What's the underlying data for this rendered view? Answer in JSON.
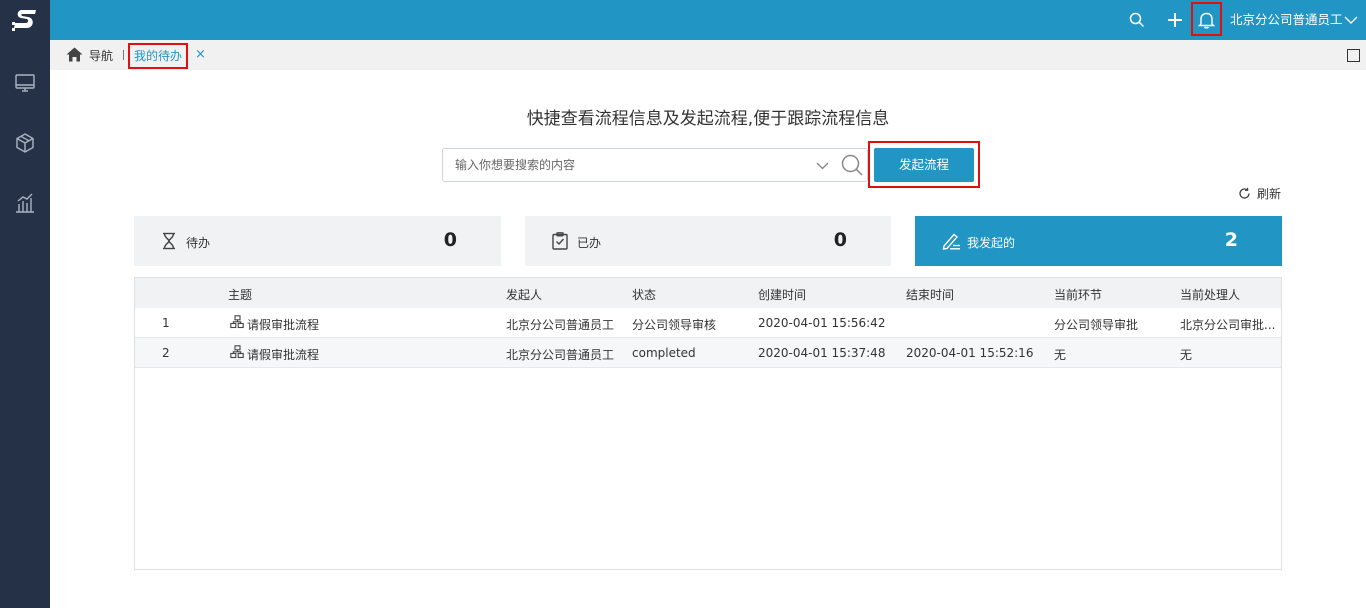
{
  "header": {
    "user_name": "北京分公司普通员工"
  },
  "icons": {
    "logo": "s-logo-icon",
    "sidebar": [
      "monitor-icon",
      "cube-icon",
      "bar-chart-icon"
    ],
    "header": [
      "search-icon",
      "plus-icon",
      "bell-icon",
      "chevron-down-icon"
    ]
  },
  "tabs": {
    "nav_label": "导航",
    "active_label": "我的待办",
    "close_glyph": "×"
  },
  "main": {
    "headline": "快捷查看流程信息及发起流程,便于跟踪流程信息",
    "search_placeholder": "输入你想要搜索的内容",
    "start_button": "发起流程",
    "refresh_label": "刷新"
  },
  "cards": [
    {
      "label": "待办",
      "count": "0",
      "icon": "hourglass-icon"
    },
    {
      "label": "已办",
      "count": "0",
      "icon": "clipboard-check-icon"
    },
    {
      "label": "我发起的",
      "count": "2",
      "icon": "edit-icon"
    }
  ],
  "table": {
    "columns": [
      "主题",
      "发起人",
      "状态",
      "创建时间",
      "结束时间",
      "当前环节",
      "当前处理人"
    ],
    "rows": [
      {
        "no": "1",
        "subject": "请假审批流程",
        "initiator": "北京分公司普通员工",
        "status": "分公司领导审核",
        "created": "2020-04-01 15:56:42",
        "ended": "",
        "stage": "分公司领导审批",
        "handler": "北京分公司审批..."
      },
      {
        "no": "2",
        "subject": "请假审批流程",
        "initiator": "北京分公司普通员工",
        "status": "completed",
        "created": "2020-04-01 15:37:48",
        "ended": "2020-04-01 15:52:16",
        "stage": "无",
        "handler": "无"
      }
    ]
  },
  "colors": {
    "sidebar": "#253146",
    "header": "#2196c4",
    "accent": "#2196c4",
    "highlight_box": "#e01010",
    "card_bg": "#f1f2f4"
  }
}
